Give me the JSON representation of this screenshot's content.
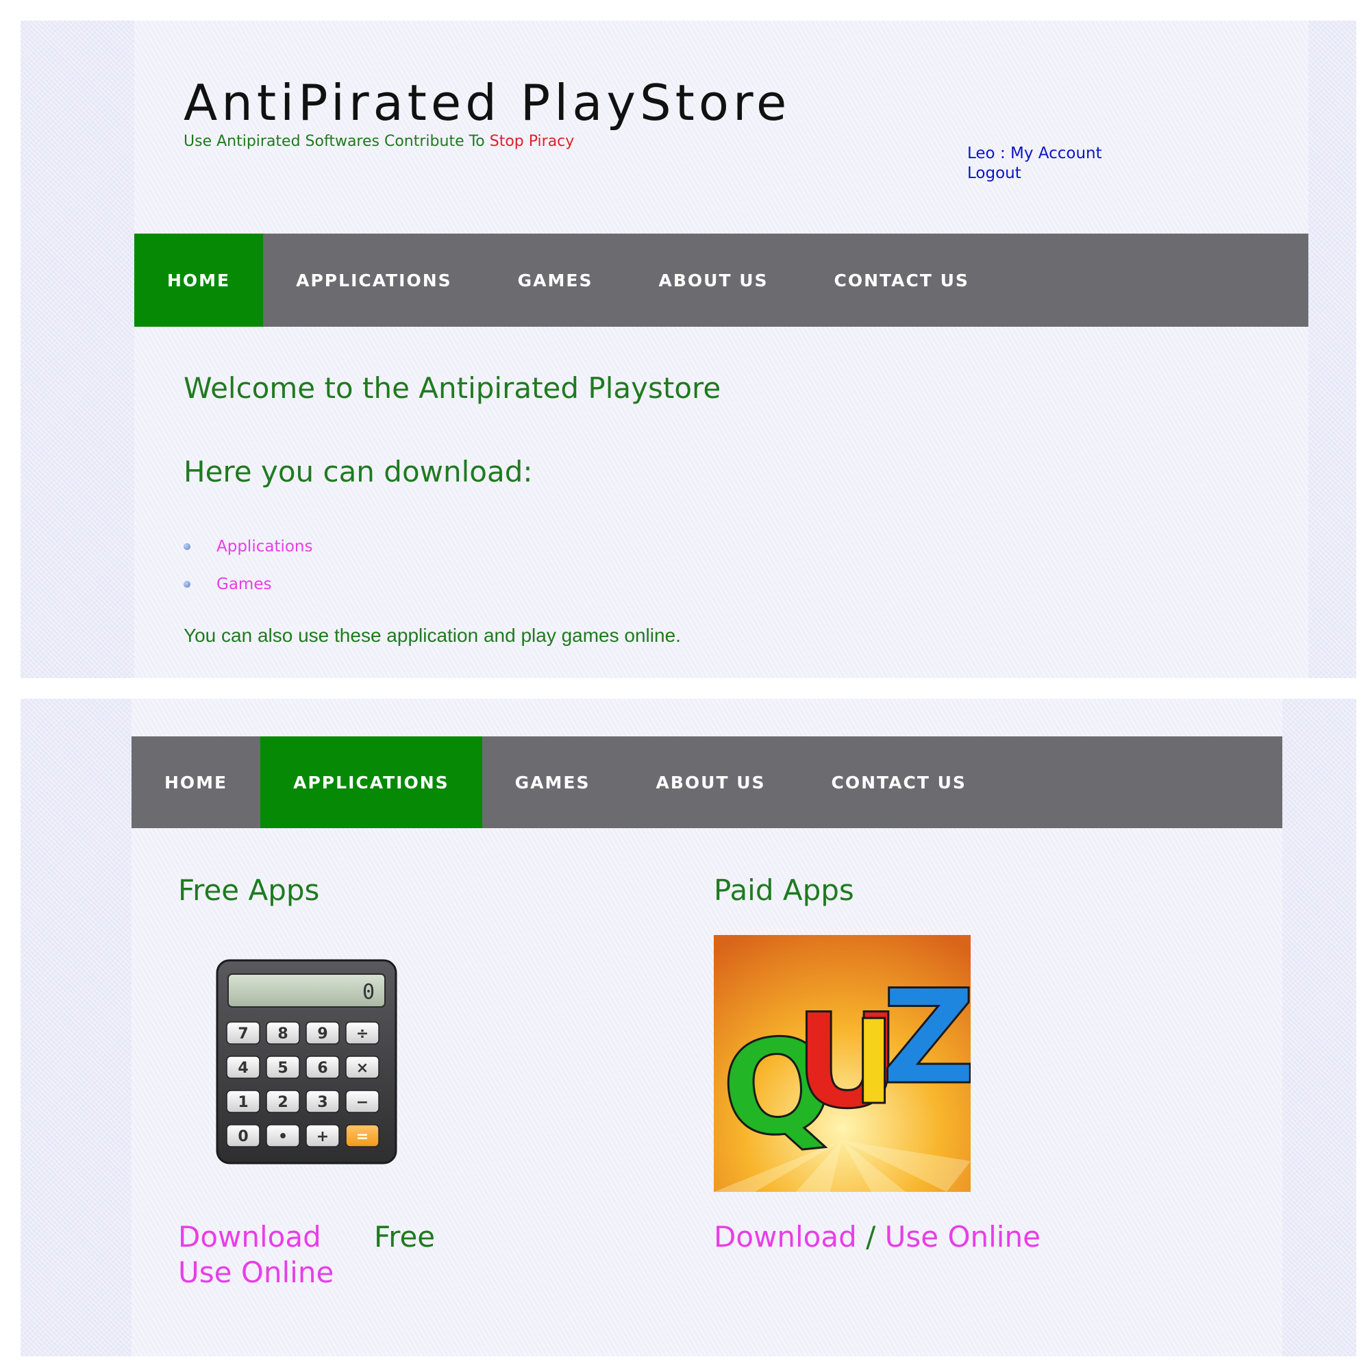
{
  "header": {
    "site_title": "AntiPirated PlayStore",
    "tagline_prefix": "Use Antipirated Softwares Contribute To ",
    "tagline_highlight": "Stop Piracy",
    "account": {
      "user": "Leo",
      "separator": " : ",
      "my_account": "My Account",
      "logout": "Logout"
    }
  },
  "nav": {
    "items": [
      "HOME",
      "APPLICATIONS",
      "GAMES",
      "ABOUT US",
      "CONTACT US"
    ],
    "top_active": "HOME",
    "bottom_active": "APPLICATIONS"
  },
  "home": {
    "welcome": "Welcome to the Antipirated Playstore",
    "download_heading": "Here you can download:",
    "links": [
      "Applications",
      "Games"
    ],
    "note": "You can also use these application and play games online."
  },
  "apps": {
    "free": {
      "title": "Free Apps",
      "image_icon": "calculator-icon",
      "calculator_display": "0",
      "calculator_keys": [
        "7",
        "8",
        "9",
        "÷",
        "4",
        "5",
        "6",
        "×",
        "1",
        "2",
        "3",
        "−",
        "0",
        "•",
        "+",
        "="
      ],
      "download": "Download",
      "price": "Free",
      "use_online": "Use Online"
    },
    "paid": {
      "title": "Paid Apps",
      "image_icon": "quiz-icon",
      "quiz_letters": [
        "Q",
        "U",
        "I",
        "Z"
      ],
      "download": "Download",
      "separator": " / ",
      "use_online": "Use Online"
    }
  },
  "colors": {
    "nav_bg": "#6b6b70",
    "nav_active": "#068a06",
    "heading_green": "#1f7a1f",
    "link_pink": "#e83ee8",
    "account_blue": "#0a14c8",
    "tag_red": "#e0202a"
  }
}
